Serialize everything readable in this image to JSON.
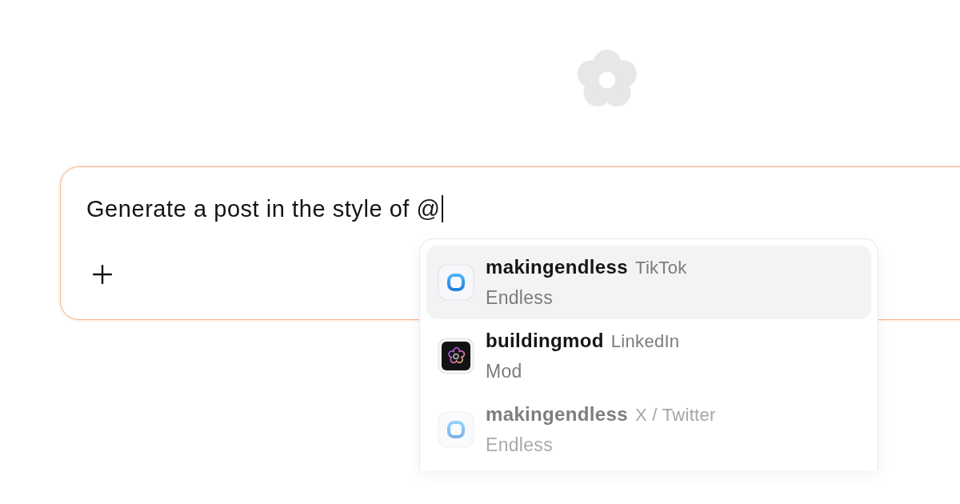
{
  "composer": {
    "value": "Generate a post in the style of @"
  },
  "mention_menu": {
    "items": [
      {
        "kind": "ring",
        "handle": "makingendless",
        "platform": "TikTok",
        "name": "Endless",
        "selected": true
      },
      {
        "kind": "flower",
        "handle": "buildingmod",
        "platform": "LinkedIn",
        "name": "Mod",
        "selected": false
      },
      {
        "kind": "ring",
        "handle": "makingendless",
        "platform": "X / Twitter",
        "name": "Endless",
        "selected": false
      }
    ]
  }
}
